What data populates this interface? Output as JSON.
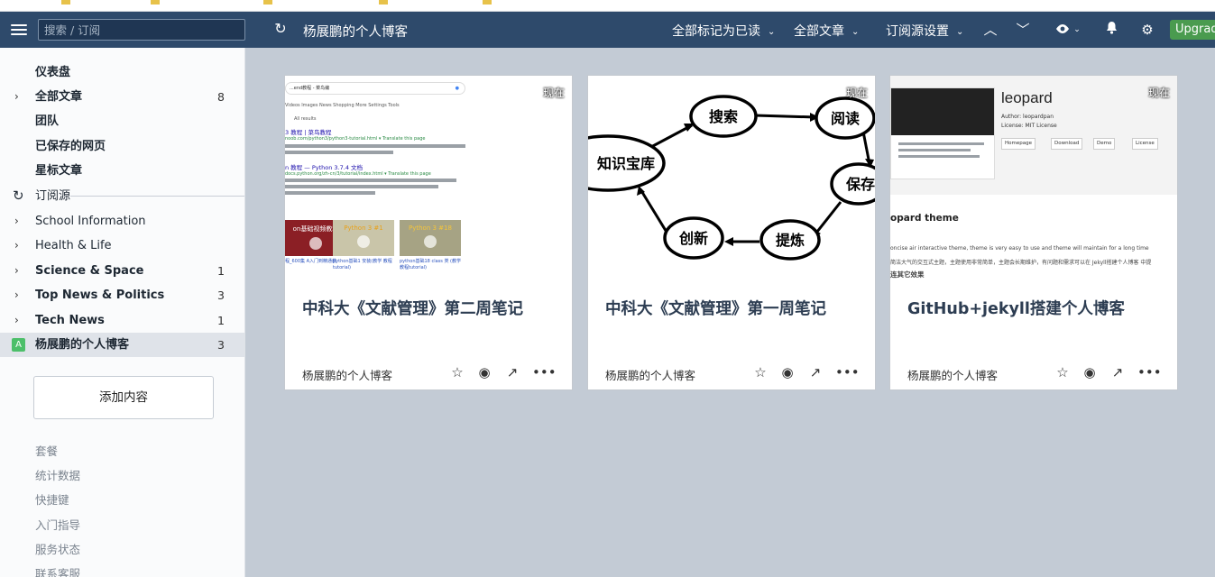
{
  "header": {
    "search_placeholder": "搜索 / 订阅",
    "feed_title": "杨展鹏的个人博客",
    "mark_all_read": "全部标记为已读",
    "all_articles": "全部文章",
    "feed_settings": "订阅源设置",
    "upgrade": "Upgrade"
  },
  "sidebar": {
    "dashboard": "仪表盘",
    "all_articles": {
      "label": "全部文章",
      "count": "8"
    },
    "team": "团队",
    "saved_pages": "已保存的网页",
    "starred": "星标文章",
    "feeds_section": "订阅源",
    "feeds": [
      {
        "label": "School Information",
        "count": ""
      },
      {
        "label": "Health & Life",
        "count": ""
      },
      {
        "label": "Science & Space",
        "count": "1"
      },
      {
        "label": "Top News & Politics",
        "count": "3"
      },
      {
        "label": "Tech News",
        "count": "1"
      },
      {
        "label": "杨展鹏的个人博客",
        "count": "3",
        "icon_letter": "A"
      }
    ],
    "add_content": "添加内容",
    "footer": [
      "套餐",
      "统计数据",
      "快捷键",
      "入门指导",
      "服务状态",
      "联系客服"
    ]
  },
  "cards": [
    {
      "badge": "现在",
      "title": "中科大《文献管理》第二周笔记",
      "source": "杨展鹏的个人博客"
    },
    {
      "badge": "现在",
      "title": "中科大《文献管理》第一周笔记",
      "source": "杨展鹏的个人博客"
    },
    {
      "badge": "现在",
      "title": "GitHub+jekyll搭建个人博客",
      "source": "杨展鹏的个人博客"
    }
  ],
  "thumb1": {
    "query": "...end教程 - 菜鸟编",
    "tabs": "Videos    Images    News    Shopping    More          Settings   Tools",
    "all_results": "All results",
    "r1_title": "3 教程 | 菜鸟教程",
    "r1_url": "noob.com/python3/python3-tutorial.html ▾ Translate this page",
    "r2_title": "n 教程 — Python 3.7.4 文档",
    "r2_url": "docs.python.org/zh-cn/3/tutorial/index.html ▾ Translate this page",
    "videos": [
      {
        "text": "on基础视频教程",
        "cap": "程_600集\nA入门到精通教"
      },
      {
        "text": "Python 3 #1",
        "cap": "python基础1 安装(教学\n教程tutorial)"
      },
      {
        "text": "Python 3 #18",
        "cap": "python基础18 class 类\n(教学教程tutorial)"
      }
    ]
  },
  "thumb2": {
    "nodes": [
      "搜索",
      "阅读",
      "知识宝库",
      "保存",
      "创新",
      "提炼"
    ]
  },
  "thumb3": {
    "repo_name": "leopard",
    "author": "Author: leopardpan",
    "license": "License: MIT License",
    "buttons": [
      "Homepage",
      "Download",
      "Demo",
      "License"
    ],
    "heading": "opard theme",
    "desc": "oncise air interactive theme, theme is very easy to use and theme will maintain for a long time",
    "desc2": "简洁大气的交互式主题，主题使用非常简单，主题会长期维护，有问题和需求可以在 Jekyll搭建个人博客 中提",
    "sub": "连其它效果"
  }
}
